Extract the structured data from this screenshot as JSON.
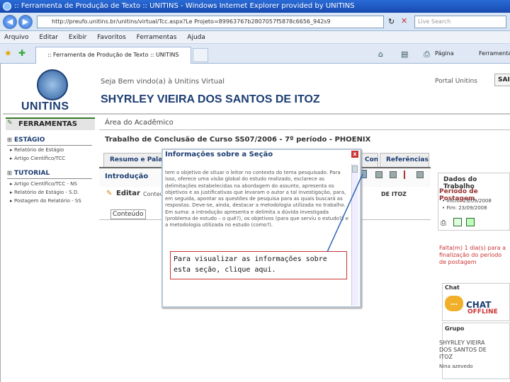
{
  "browser": {
    "title": ":: Ferramenta de Produção de Texto :: UNITINS - Windows Internet Explorer provided by UNITINS",
    "url": "http://preufo.unitins.br/unitins/virtual/Tcc.aspx?Le Projeto=89963767b2807057f5878c6656_942s9",
    "search_placeholder": "Live Search",
    "menu": [
      "Arquivo",
      "Editar",
      "Exibir",
      "Favoritos",
      "Ferramentas",
      "Ajuda"
    ],
    "tab_label": ":: Ferramenta de Produção de Texto :: UNITINS",
    "page_menu": "Página",
    "tools_menu": "Ferramentas"
  },
  "header": {
    "logo_text": "UNITINS",
    "welcome": "Seja Bem vindo(a) à Unitins Virtual",
    "portal_link": "Portal Unitins",
    "exit": "SAIR",
    "username": "SHYRLEY VIEIRA DOS SANTOS DE ITOZ"
  },
  "sidebar": {
    "heading": "FERRAMENTAS",
    "sections": [
      {
        "title": "ESTÁGIO",
        "items": [
          "Relatório de Estágio",
          "Artigo Científico/TCC"
        ]
      },
      {
        "title": "TUTORIAL",
        "items": [
          "Artigo Científico/TCC - NS",
          "Relatório de Estágio - S.D.",
          "Postagem do Relatório - SS"
        ]
      }
    ]
  },
  "main": {
    "area_title": "Área do Acadêmico",
    "tcc_title": "Trabalho de Conclusão de Curso SS07/2006 - 7º período - PHOENIX",
    "tabs": [
      "Resumo e Palavras-Chaves",
      "Conclusão",
      "Referências"
    ],
    "section_label": "Introdução",
    "edit_label": "Editar",
    "edit_suffix": "Conteúdo",
    "content_label": "Conteúdo",
    "student_short": "DE ITOZ"
  },
  "right": {
    "dados_head": "Dados do Trabalho",
    "periodo": "Período de Postagem",
    "inicio": "• Início: 23/09/2008",
    "fim": "• Fim: 23/09/2008",
    "falta": "Falta(m) 1 dia(s) para a finalização do período de postagem",
    "chat_head": "Chat",
    "chat_label": "CHAT",
    "chat_status": "OFFLINE",
    "grupo_head": "Grupo",
    "grupo_member": "SHYRLEY VIEIRA DOS SANTOS DE ITOZ",
    "grupo_member2": "Nina azevedo"
  },
  "modal": {
    "title": "Informações sobre a Seção",
    "close": "x",
    "body": "tem o objetivo de situar o leitor no contexto do tema pesquisado. Para isso, oferece uma visão global do estudo realizado, esclarece as delimitações estabelecidas na abordagem do assunto, apresenta os objetivos e as justificativas que levaram o autor a tal investigação, para, em seguida, apontar as questões de pesquisa para as quais buscará as respostas. Deve-se, ainda, destacar a metodologia utilizada no trabalho. Em suma: a introdução apresenta e delimita a dúvida investigada (problema de estudo – o quê?), os objetivos (para que serviu o estudo?) e a metodologia utilizada no estudo (como?)."
  },
  "callout": {
    "text": "Para visualizar as informações sobre esta seção, clique aqui."
  },
  "colors": {
    "brand_navy": "#1c3d73",
    "alert_red": "#cc3333",
    "chat_orange": "#f2b02a"
  }
}
